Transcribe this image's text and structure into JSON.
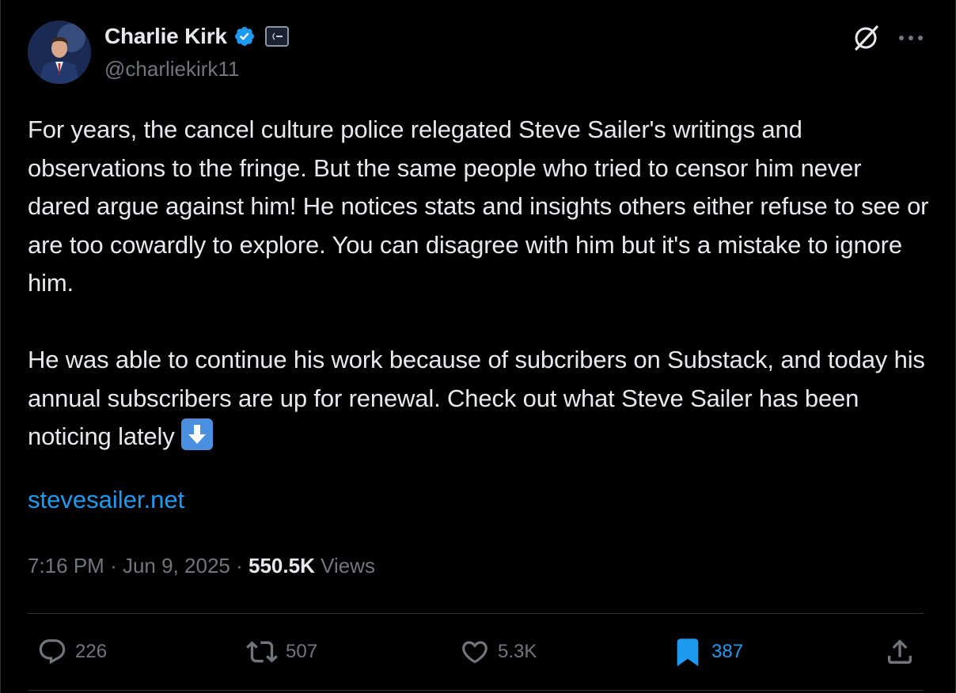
{
  "author": {
    "name": "Charlie Kirk",
    "handle": "@charliekirk11",
    "verified_color": "#1d9bf0"
  },
  "post": {
    "paragraph1": "For years, the cancel culture police relegated Steve Sailer's writings and observations to the fringe. But the same people who tried to censor him never dared argue against him! He notices stats and insights others either refuse to see or are too cowardly to explore. You can disagree with him but it's a mistake to ignore him.",
    "paragraph2": "He was able to continue his work because of subcribers on Substack, and today his annual subscribers are up for renewal. Check out what Steve Sailer has been noticing lately",
    "link": "stevesailer.net"
  },
  "meta": {
    "time": "7:16 PM",
    "separator": "·",
    "date": "Jun 9, 2025",
    "views_count": "550.5K",
    "views_label": "Views"
  },
  "actions": {
    "replies": "226",
    "reposts": "507",
    "likes": "5.3K",
    "bookmarks": "387"
  },
  "icons": {
    "header": [
      "grok-icon",
      "more-icon"
    ],
    "actions": [
      "reply-icon",
      "repost-icon",
      "like-icon",
      "bookmark-icon",
      "share-icon"
    ]
  },
  "colors": {
    "background": "#000000",
    "text": "#e7e9ea",
    "muted": "#71767b",
    "link": "#1d9bf0"
  }
}
